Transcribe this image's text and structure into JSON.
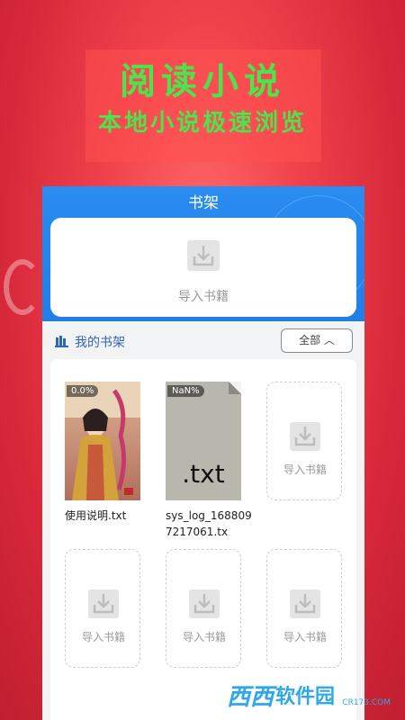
{
  "promo": {
    "title": "阅读小说",
    "subtitle": "本地小说极速浏览"
  },
  "app": {
    "title": "书架",
    "import_label": "导入书籍",
    "shelf_title": "我的书架",
    "filter_label": "全部 ︿"
  },
  "books": [
    {
      "name": "使用说明.txt",
      "progress": "0.0%"
    },
    {
      "name": "sys_log_1688097217061.tx",
      "progress": "NaN%",
      "extension": ".txt"
    }
  ],
  "empty_slot_label": "导入书籍",
  "watermark": {
    "logo": "西西",
    "text": "软件园",
    "url": "CR173.COM"
  },
  "colors": {
    "background": "#d7283a",
    "promo_text": "#4ee24e",
    "header_blue": "#1e7fe8",
    "shelf_title": "#2f66b3"
  }
}
